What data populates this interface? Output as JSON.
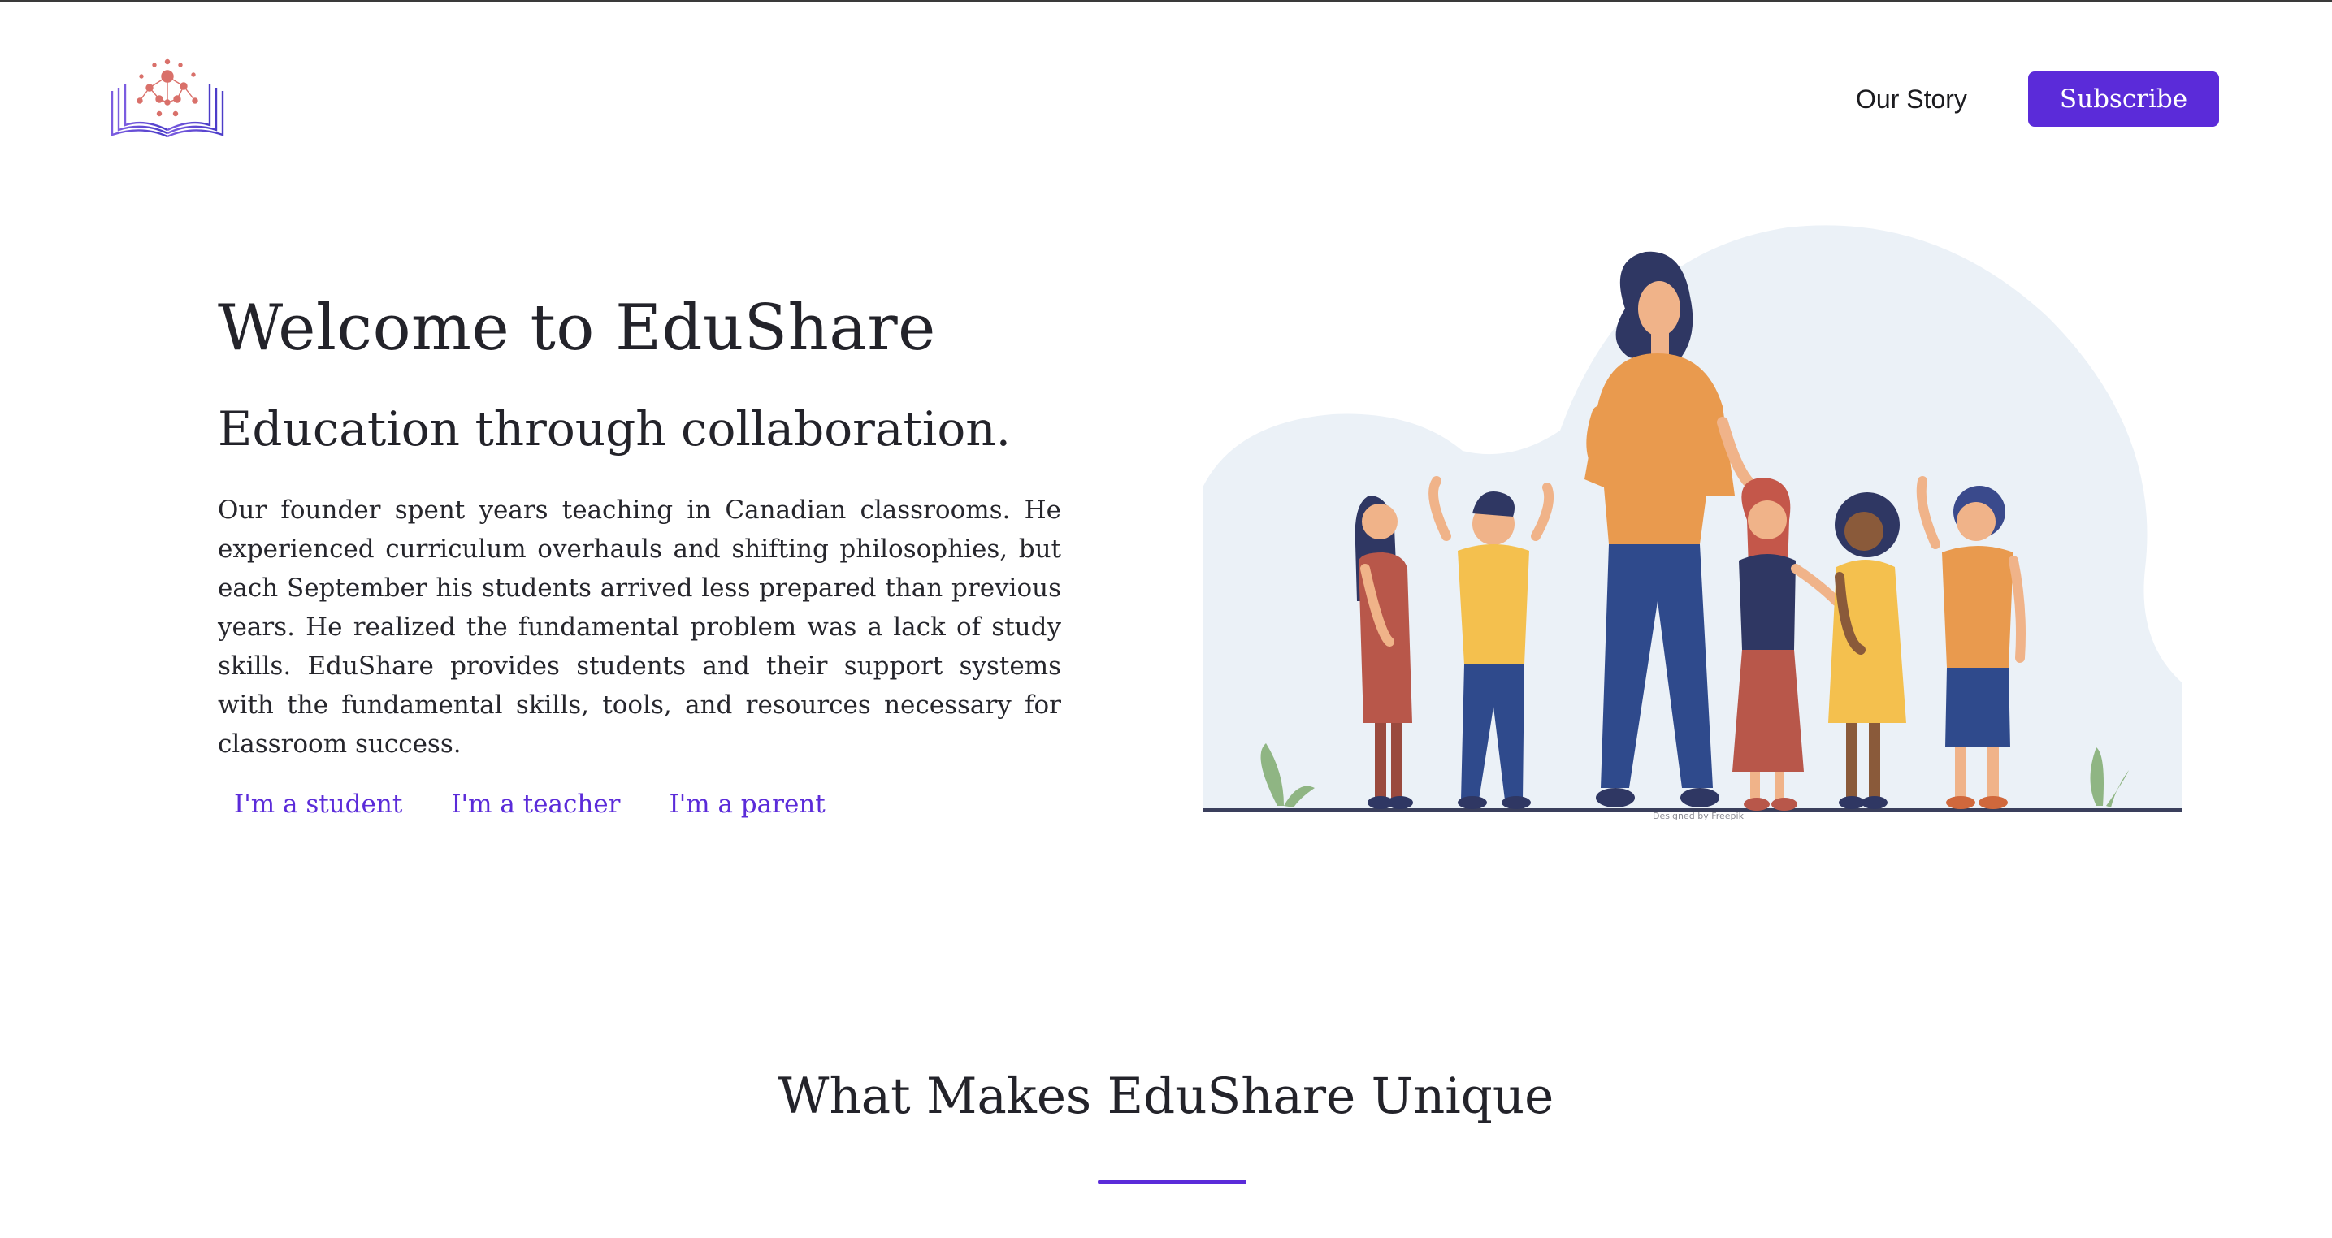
{
  "header": {
    "logo_alt": "EduShare logo",
    "nav": [
      {
        "label": "Our Story"
      }
    ],
    "subscribe_label": "Subscribe"
  },
  "hero": {
    "title": "Welcome to EduShare",
    "subtitle": "Education through collaboration.",
    "body": "Our founder spent years teaching in Canadian classrooms. He experienced curriculum overhauls and shifting philosophies, but each September his students arrived less prepared than previous years. He realized the fundamental problem was a lack of study skills. EduShare provides students and their support systems with the fundamental skills, tools, and resources necessary for classroom success.",
    "roles": [
      {
        "label": "I'm a student"
      },
      {
        "label": "I'm a teacher"
      },
      {
        "label": "I'm a parent"
      }
    ],
    "illustration_credit": "Designed by Freepik"
  },
  "section": {
    "title": "What Makes EduShare Unique"
  },
  "colors": {
    "accent": "#5b2bd9",
    "text": "#23232a",
    "blob": "#ebf1f7"
  },
  "icons": [
    "book-logo-icon"
  ]
}
